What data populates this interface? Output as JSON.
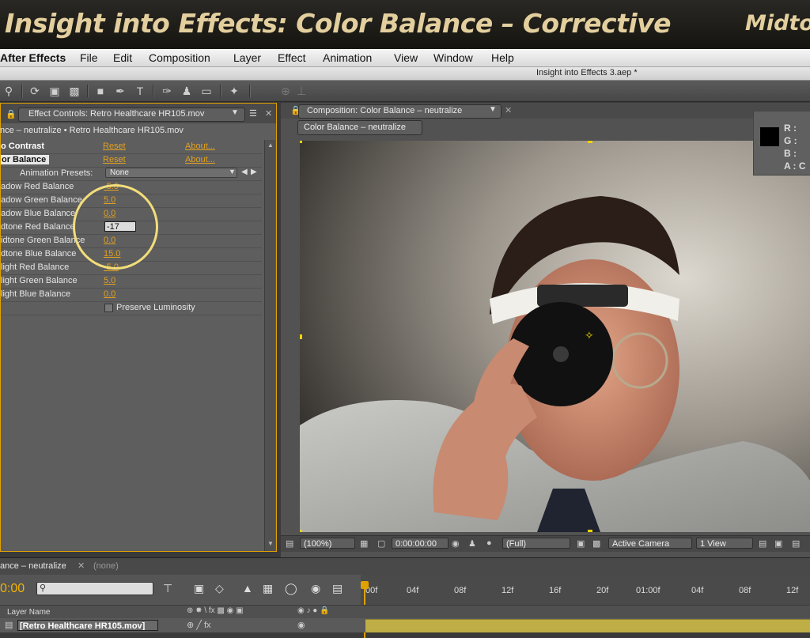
{
  "banner": {
    "title": "Insight into Effects: Color Balance – Corrective",
    "right_text": "Midtor"
  },
  "menu": {
    "app": "After Effects",
    "items": [
      "File",
      "Edit",
      "Composition",
      "Layer",
      "Effect",
      "Animation",
      "View",
      "Window",
      "Help"
    ]
  },
  "project_title": "Insight into Effects 3.aep *",
  "effect_controls": {
    "tab_label": "Effect Controls: Retro Healthcare HR105.mov",
    "subtitle": "nce – neutralize • Retro Healthcare HR105.mov",
    "effects": [
      {
        "name": "o Contrast",
        "reset": "Reset",
        "about": "About..."
      },
      {
        "name": "or Balance",
        "reset": "Reset",
        "about": "About..."
      }
    ],
    "presets_label": "Animation Presets:",
    "presets_value": "None",
    "params": [
      {
        "label": "adow Red Balance",
        "value": "-5.0"
      },
      {
        "label": "adow Green Balance",
        "value": "5.0"
      },
      {
        "label": "adow Blue Balance",
        "value": "0.0"
      },
      {
        "label": "dtone Red Balance",
        "value": "-17"
      },
      {
        "label": "idtone Green Balance",
        "value": "0.0"
      },
      {
        "label": "dtone Blue Balance",
        "value": "15.0"
      },
      {
        "label": "light Red Balance",
        "value": "-5.0"
      },
      {
        "label": "light Green Balance",
        "value": "5.0"
      },
      {
        "label": "light Blue Balance",
        "value": "0.0"
      }
    ],
    "preserve_label": "Preserve Luminosity"
  },
  "composition": {
    "tab_label": "Composition: Color Balance – neutralize",
    "pill": "Color Balance – neutralize",
    "info": {
      "r": "R :",
      "g": "G :",
      "b": "B :",
      "a": "A : C"
    },
    "footer": {
      "zoom": "(100%)",
      "timecode": "0:00:00:00",
      "resolution": "(Full)",
      "camera": "Active Camera",
      "views": "1 View"
    }
  },
  "timeline": {
    "tab1": "ance – neutralize",
    "tab2": "(none)",
    "time": "0:00",
    "layer_name_header": "Layer Name",
    "ticks": [
      "00f",
      "04f",
      "08f",
      "12f",
      "16f",
      "20f",
      "01:00f",
      "04f",
      "08f",
      "12f"
    ],
    "layer": "[Retro Healthcare HR105.mov]"
  },
  "colors": {
    "accent": "#e0a000",
    "link": "#e0a020",
    "panel_bg": "#5e5e5e",
    "banner_text": "#e3cf9e"
  }
}
